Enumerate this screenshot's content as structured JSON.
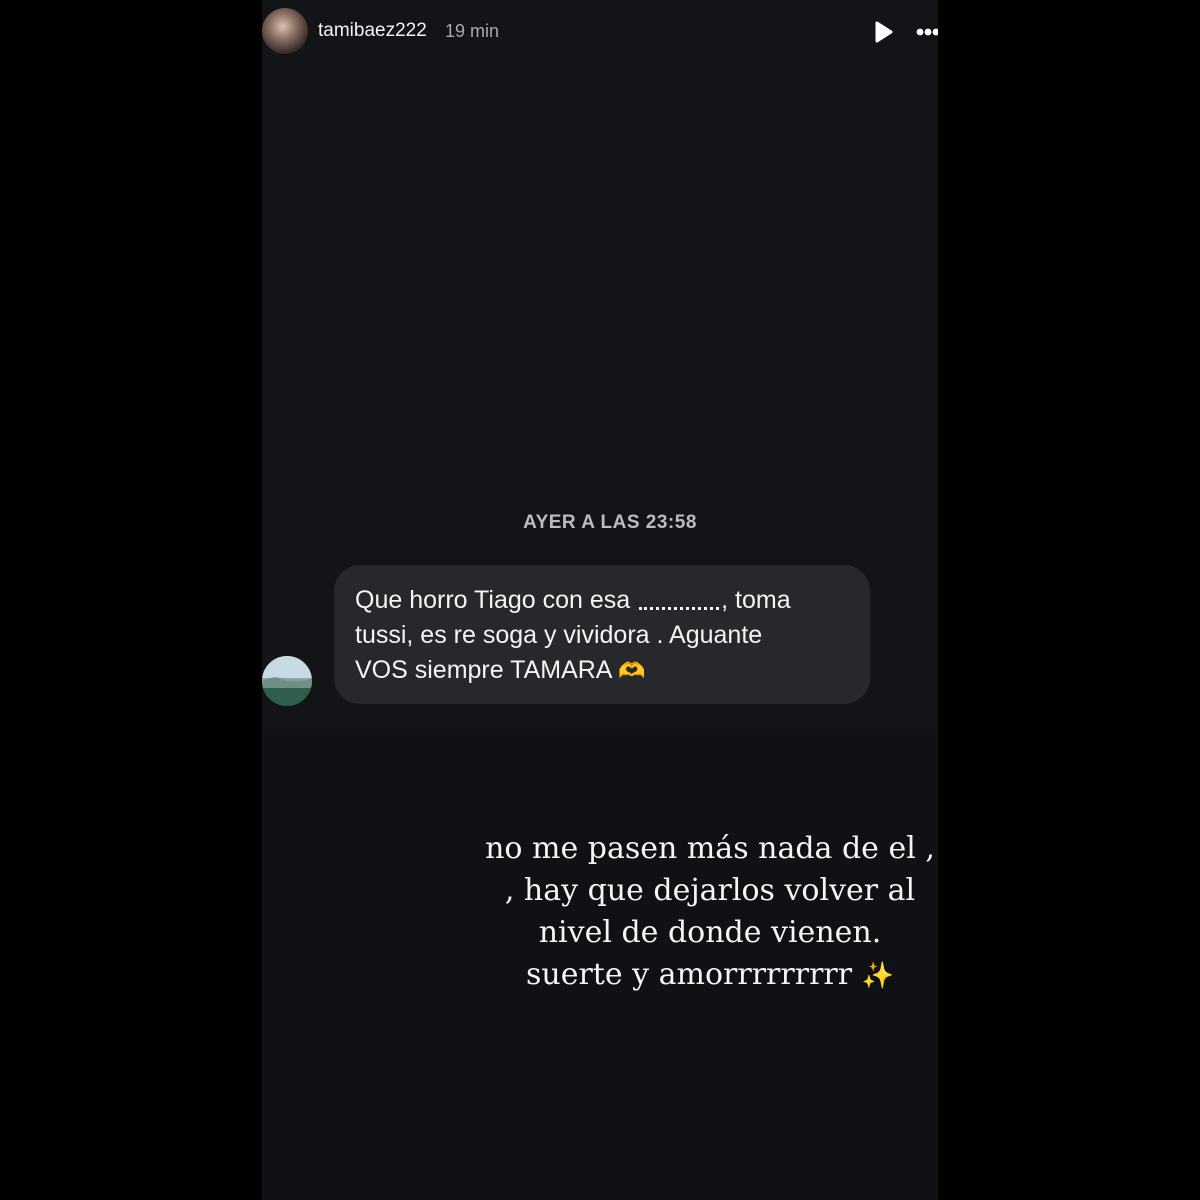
{
  "header": {
    "username": "tamibaez222",
    "time_ago": "19 min",
    "profile_avatar_icon": "profile-avatar",
    "play_icon": "play-icon",
    "more_icon": "more-options-icon"
  },
  "message": {
    "timestamp": "AYER A LAS 23:58",
    "sender_avatar_icon": "sender-avatar",
    "line1_before": "Que horro Tiago con esa",
    "line1_after": ", toma",
    "line2": "tussi, es re soga y vividora . Aguante",
    "line3": "VOS siempre TAMARA",
    "line3_emoji": "🫶",
    "bubble_color": "#26282c"
  },
  "caption": {
    "line1": "no me pasen más nada de el ,",
    "line2": ", hay que dejarlos volver al",
    "line3": "nivel de donde vienen.",
    "line4": "suerte y amorrrrrrrrr",
    "line4_emoji": "✨"
  },
  "colors": {
    "story_background": "#121418",
    "outer_background": "#000000"
  }
}
